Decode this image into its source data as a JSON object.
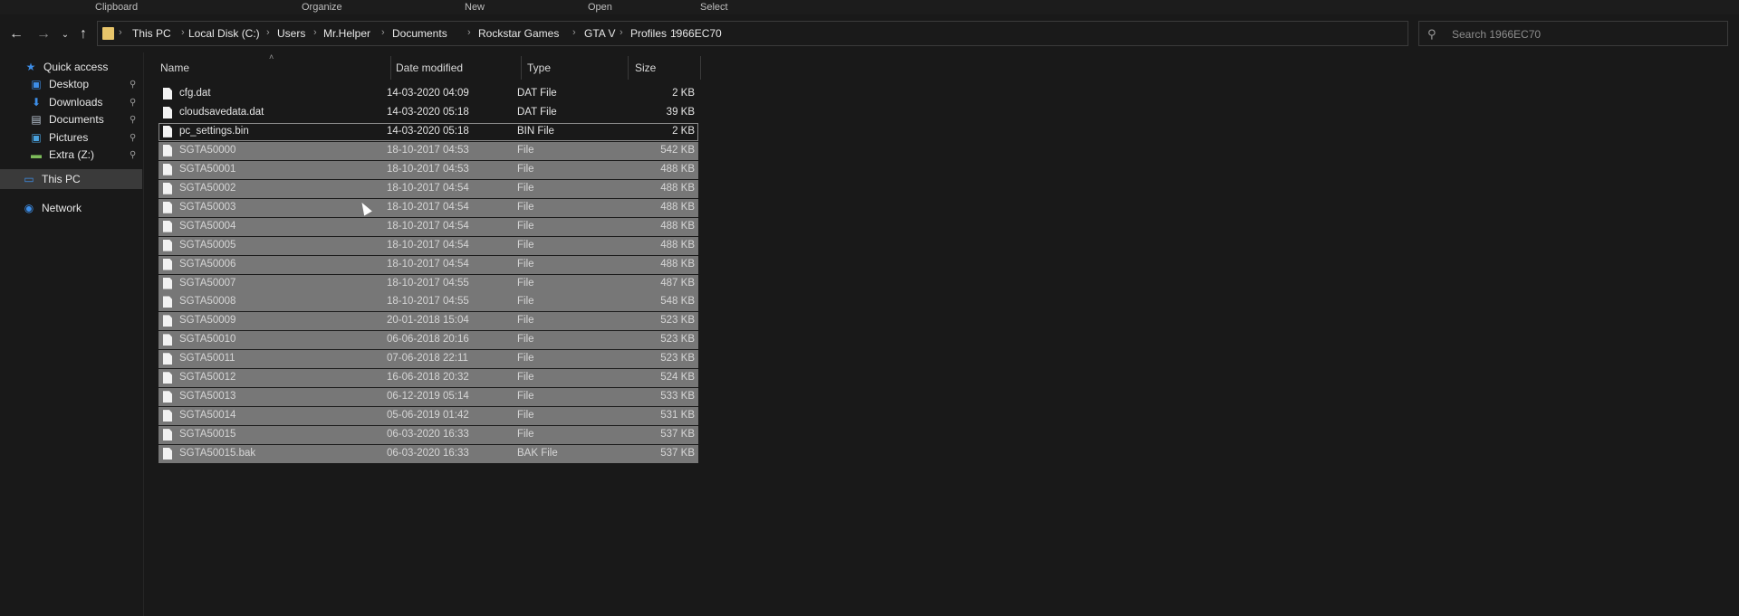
{
  "ribbon": {
    "groups": [
      "Clipboard",
      "Organize",
      "New",
      "Open",
      "Select"
    ]
  },
  "address": {
    "crumbs": [
      "This PC",
      "Local Disk (C:)",
      "Users",
      "Mr.Helper",
      "Documents",
      "Rockstar Games",
      "GTA V",
      "Profiles",
      "1966EC70"
    ]
  },
  "search": {
    "placeholder": "Search 1966EC70"
  },
  "nav": {
    "items": [
      {
        "label": "Quick access",
        "icon": "star-icon"
      },
      {
        "label": "Desktop",
        "icon": "desktop-icon",
        "pinned": true
      },
      {
        "label": "Downloads",
        "icon": "download-icon",
        "pinned": true
      },
      {
        "label": "Documents",
        "icon": "document-icon",
        "pinned": true
      },
      {
        "label": "Pictures",
        "icon": "picture-icon",
        "pinned": true
      },
      {
        "label": "Extra (Z:)",
        "icon": "drive-icon",
        "pinned": true
      },
      {
        "label": "This PC",
        "icon": "computer-icon",
        "selected": true
      },
      {
        "label": "Network",
        "icon": "network-icon"
      }
    ]
  },
  "columns": {
    "name": "Name",
    "date": "Date modified",
    "type": "Type",
    "size": "Size"
  },
  "files": [
    {
      "name": "cfg.dat",
      "date": "14-03-2020 04:09",
      "type": "DAT File",
      "size": "2 KB",
      "selected": false
    },
    {
      "name": "cloudsavedata.dat",
      "date": "14-03-2020 05:18",
      "type": "DAT File",
      "size": "39 KB",
      "selected": false
    },
    {
      "name": "pc_settings.bin",
      "date": "14-03-2020 05:18",
      "type": "BIN File",
      "size": "2 KB",
      "selected": false
    },
    {
      "name": "SGTA50000",
      "date": "18-10-2017 04:53",
      "type": "File",
      "size": "542 KB",
      "selected": true
    },
    {
      "name": "SGTA50001",
      "date": "18-10-2017 04:53",
      "type": "File",
      "size": "488 KB",
      "selected": true
    },
    {
      "name": "SGTA50002",
      "date": "18-10-2017 04:54",
      "type": "File",
      "size": "488 KB",
      "selected": true
    },
    {
      "name": "SGTA50003",
      "date": "18-10-2017 04:54",
      "type": "File",
      "size": "488 KB",
      "selected": true
    },
    {
      "name": "SGTA50004",
      "date": "18-10-2017 04:54",
      "type": "File",
      "size": "488 KB",
      "selected": true
    },
    {
      "name": "SGTA50005",
      "date": "18-10-2017 04:54",
      "type": "File",
      "size": "488 KB",
      "selected": true
    },
    {
      "name": "SGTA50006",
      "date": "18-10-2017 04:54",
      "type": "File",
      "size": "488 KB",
      "selected": true
    },
    {
      "name": "SGTA50007",
      "date": "18-10-2017 04:55",
      "type": "File",
      "size": "487 KB",
      "selected": true
    },
    {
      "name": "SGTA50008",
      "date": "18-10-2017 04:55",
      "type": "File",
      "size": "548 KB",
      "selected": true
    },
    {
      "name": "SGTA50009",
      "date": "20-01-2018 15:04",
      "type": "File",
      "size": "523 KB",
      "selected": true
    },
    {
      "name": "SGTA50010",
      "date": "06-06-2018 20:16",
      "type": "File",
      "size": "523 KB",
      "selected": true
    },
    {
      "name": "SGTA50011",
      "date": "07-06-2018 22:11",
      "type": "File",
      "size": "523 KB",
      "selected": true
    },
    {
      "name": "SGTA50012",
      "date": "16-06-2018 20:32",
      "type": "File",
      "size": "524 KB",
      "selected": true
    },
    {
      "name": "SGTA50013",
      "date": "06-12-2019 05:14",
      "type": "File",
      "size": "533 KB",
      "selected": true
    },
    {
      "name": "SGTA50014",
      "date": "05-06-2019 01:42",
      "type": "File",
      "size": "531 KB",
      "selected": true
    },
    {
      "name": "SGTA50015",
      "date": "06-03-2020 16:33",
      "type": "File",
      "size": "537 KB",
      "selected": true
    },
    {
      "name": "SGTA50015.bak",
      "date": "06-03-2020 16:33",
      "type": "BAK File",
      "size": "537 KB",
      "selected": true
    }
  ]
}
